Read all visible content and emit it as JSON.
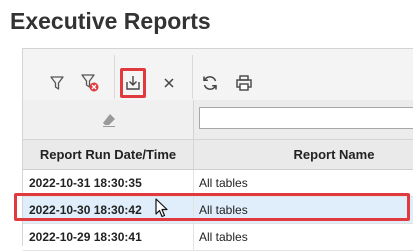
{
  "page": {
    "title": "Executive Reports"
  },
  "toolbar": {
    "buttons": [
      {
        "name": "filter",
        "icon": "filter-icon"
      },
      {
        "name": "clear-filter",
        "icon": "filter-clear-icon"
      },
      {
        "name": "export",
        "icon": "download-icon",
        "highlighted": true
      },
      {
        "name": "close",
        "icon": "close-icon"
      },
      {
        "name": "refresh",
        "icon": "refresh-icon"
      },
      {
        "name": "print",
        "icon": "print-icon"
      }
    ]
  },
  "filter_row": {
    "edit_icon": "eraser-icon",
    "input_value": ""
  },
  "table": {
    "columns": [
      "Report Run Date/Time",
      "Report Name"
    ],
    "rows": [
      {
        "datetime": "2022-10-31 18:30:35",
        "name": "All tables",
        "selected": false
      },
      {
        "datetime": "2022-10-30 18:30:42",
        "name": "All tables",
        "selected": true
      },
      {
        "datetime": "2022-10-29 18:30:41",
        "name": "All tables",
        "selected": false
      }
    ]
  },
  "colors": {
    "highlight": "#e0393e",
    "selection": "#dfeefa",
    "alert": "#e0393e"
  }
}
